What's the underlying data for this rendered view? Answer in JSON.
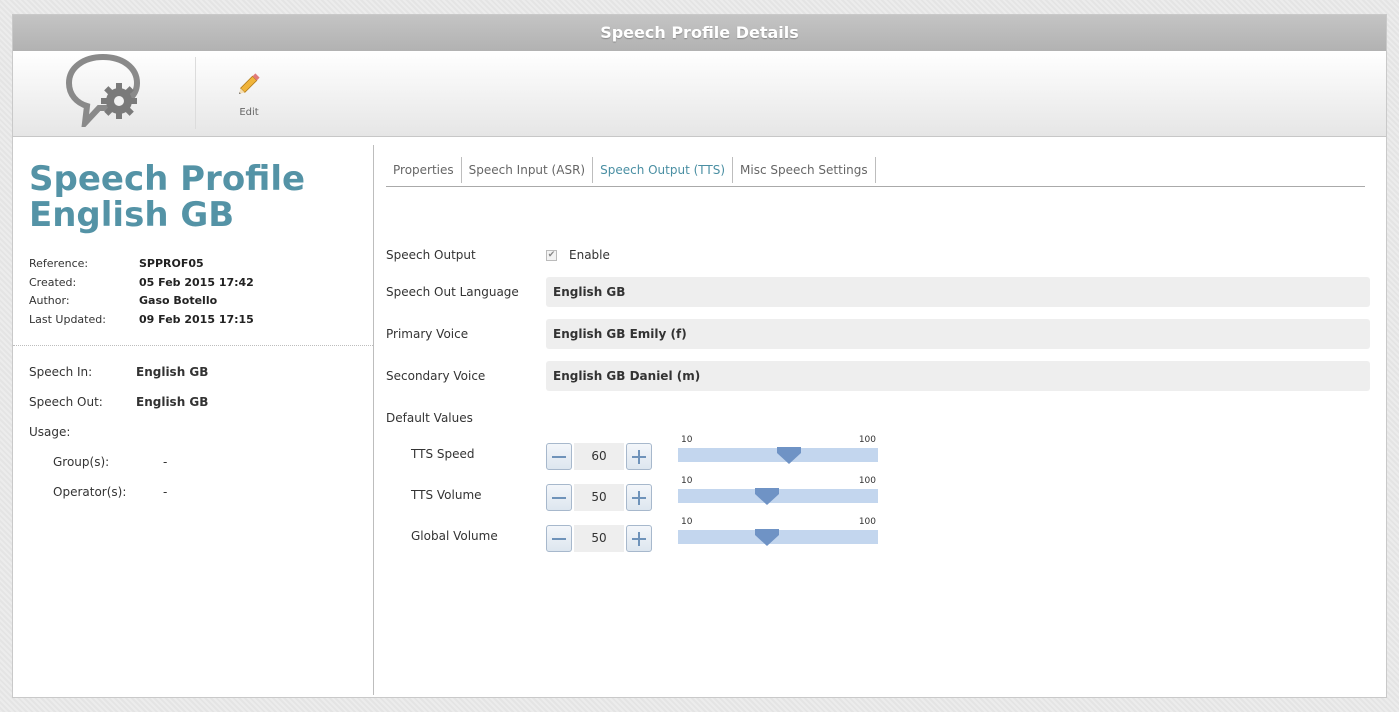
{
  "window": {
    "title": "Speech Profile Details"
  },
  "toolbar": {
    "edit_label": "Edit",
    "edit_icon": "pencil-icon",
    "logo_icon": "speech-gear-icon"
  },
  "profile": {
    "title_line1": "Speech Profile",
    "title_line2": "English GB",
    "meta": [
      {
        "key": "Reference:",
        "value": "SPPROF05"
      },
      {
        "key": "Created:",
        "value": "05 Feb 2015 17:42"
      },
      {
        "key": "Author:",
        "value": "Gaso Botello"
      },
      {
        "key": "Last Updated:",
        "value": "09 Feb 2015 17:15"
      }
    ],
    "summary": {
      "speech_in_label": "Speech In:",
      "speech_in_value": "English GB",
      "speech_out_label": "Speech Out:",
      "speech_out_value": "English GB",
      "usage_label": "Usage:",
      "groups_label": "Group(s):",
      "groups_value": "-",
      "operators_label": "Operator(s):",
      "operators_value": "-"
    }
  },
  "tabs": [
    {
      "label": "Properties",
      "active": false
    },
    {
      "label": "Speech Input (ASR)",
      "active": false
    },
    {
      "label": "Speech Output (TTS)",
      "active": true
    },
    {
      "label": "Misc Speech Settings",
      "active": false
    }
  ],
  "form": {
    "speech_output_label": "Speech Output",
    "enable_label": "Enable",
    "enable_checked": true,
    "language_label": "Speech Out Language",
    "language_value": "English GB",
    "primary_label": "Primary Voice",
    "primary_value": "English GB Emily (f)",
    "secondary_label": "Secondary Voice",
    "secondary_value": "English GB Daniel (m)",
    "defaults_label": "Default Values",
    "sliders": [
      {
        "label": "TTS Speed",
        "value": "60",
        "min": "10",
        "max": "100",
        "level": 60
      },
      {
        "label": "TTS Volume",
        "value": "50",
        "min": "10",
        "max": "100",
        "level": 50
      },
      {
        "label": "Global Volume",
        "value": "50",
        "min": "10",
        "max": "100",
        "level": 50
      }
    ]
  },
  "colors": {
    "accent": "#5493a6",
    "tab_active": "#4a8fa3",
    "slider_track": "#c3d6ee",
    "slider_thumb": "#6f93c5"
  }
}
